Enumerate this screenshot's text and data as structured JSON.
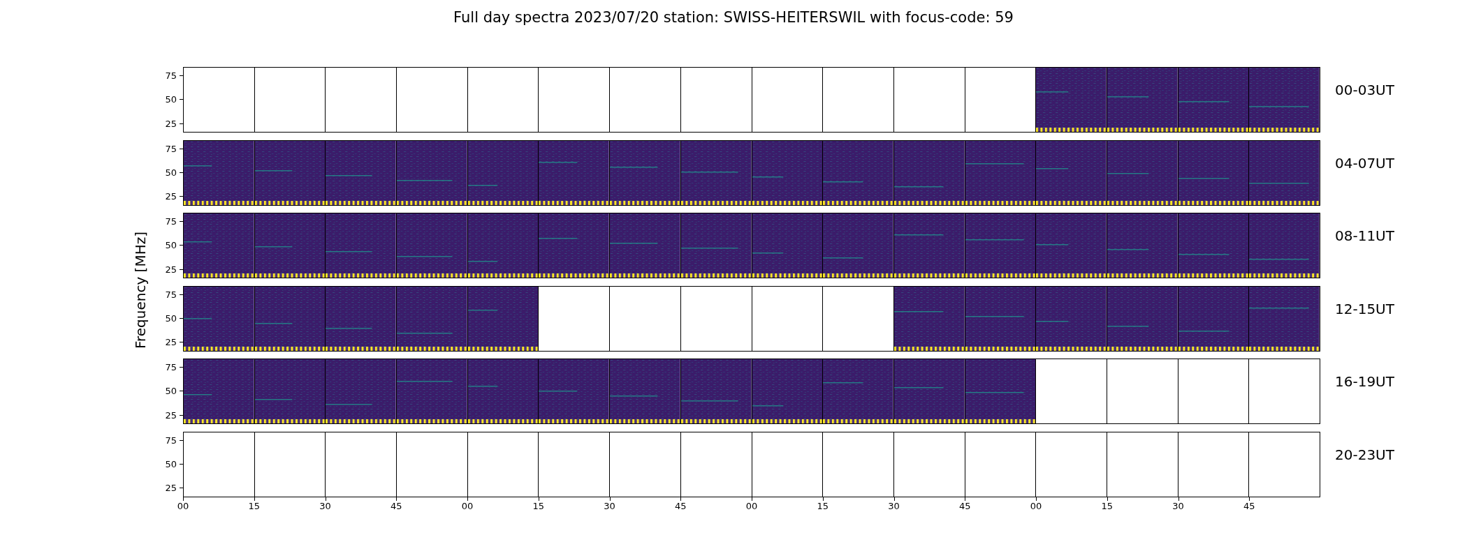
{
  "title": "Full day spectra 2023/07/20 station: SWISS-HEITERSWIL with focus-code: 59",
  "ylabel": "Frequency [MHz]",
  "rows": [
    {
      "label": "00-03UT",
      "yticks": [
        "75",
        "50",
        "25"
      ],
      "panels": [
        {
          "filled": false
        },
        {
          "filled": false
        },
        {
          "filled": false
        },
        {
          "filled": false
        },
        {
          "filled": false
        },
        {
          "filled": false
        },
        {
          "filled": false
        },
        {
          "filled": false
        },
        {
          "filled": false
        },
        {
          "filled": false
        },
        {
          "filled": false
        },
        {
          "filled": false
        },
        {
          "filled": true
        },
        {
          "filled": true
        },
        {
          "filled": true
        },
        {
          "filled": true
        }
      ]
    },
    {
      "label": "04-07UT",
      "yticks": [
        "75",
        "50",
        "25"
      ],
      "panels": [
        {
          "filled": true
        },
        {
          "filled": true
        },
        {
          "filled": true
        },
        {
          "filled": true
        },
        {
          "filled": true
        },
        {
          "filled": true
        },
        {
          "filled": true
        },
        {
          "filled": true
        },
        {
          "filled": true
        },
        {
          "filled": true
        },
        {
          "filled": true
        },
        {
          "filled": true
        },
        {
          "filled": true
        },
        {
          "filled": true
        },
        {
          "filled": true
        },
        {
          "filled": true
        }
      ]
    },
    {
      "label": "08-11UT",
      "yticks": [
        "75",
        "50",
        "25"
      ],
      "panels": [
        {
          "filled": true
        },
        {
          "filled": true
        },
        {
          "filled": true
        },
        {
          "filled": true
        },
        {
          "filled": true
        },
        {
          "filled": true
        },
        {
          "filled": true
        },
        {
          "filled": true
        },
        {
          "filled": true
        },
        {
          "filled": true
        },
        {
          "filled": true
        },
        {
          "filled": true
        },
        {
          "filled": true
        },
        {
          "filled": true
        },
        {
          "filled": true
        },
        {
          "filled": true
        }
      ]
    },
    {
      "label": "12-15UT",
      "yticks": [
        "75",
        "50",
        "25"
      ],
      "panels": [
        {
          "filled": true
        },
        {
          "filled": true
        },
        {
          "filled": true
        },
        {
          "filled": true
        },
        {
          "filled": true
        },
        {
          "filled": false
        },
        {
          "filled": false
        },
        {
          "filled": false
        },
        {
          "filled": false
        },
        {
          "filled": false
        },
        {
          "filled": true
        },
        {
          "filled": true
        },
        {
          "filled": true
        },
        {
          "filled": true
        },
        {
          "filled": true
        },
        {
          "filled": true
        }
      ]
    },
    {
      "label": "16-19UT",
      "yticks": [
        "75",
        "50",
        "25"
      ],
      "panels": [
        {
          "filled": true
        },
        {
          "filled": true
        },
        {
          "filled": true
        },
        {
          "filled": true
        },
        {
          "filled": true
        },
        {
          "filled": true
        },
        {
          "filled": true
        },
        {
          "filled": true
        },
        {
          "filled": true
        },
        {
          "filled": true
        },
        {
          "filled": true
        },
        {
          "filled": true
        },
        {
          "filled": false
        },
        {
          "filled": false
        },
        {
          "filled": false
        },
        {
          "filled": false
        }
      ]
    },
    {
      "label": "20-23UT",
      "yticks": [
        "75",
        "50",
        "25"
      ],
      "panels": [
        {
          "filled": false
        },
        {
          "filled": false
        },
        {
          "filled": false
        },
        {
          "filled": false
        },
        {
          "filled": false
        },
        {
          "filled": false
        },
        {
          "filled": false
        },
        {
          "filled": false
        },
        {
          "filled": false
        },
        {
          "filled": false
        },
        {
          "filled": false
        },
        {
          "filled": false
        },
        {
          "filled": false
        },
        {
          "filled": false
        },
        {
          "filled": false
        },
        {
          "filled": false
        }
      ]
    }
  ],
  "xticks": [
    "00",
    "15",
    "30",
    "45",
    "00",
    "15",
    "30",
    "45",
    "00",
    "15",
    "30",
    "45",
    "00",
    "15",
    "30",
    "45"
  ]
}
